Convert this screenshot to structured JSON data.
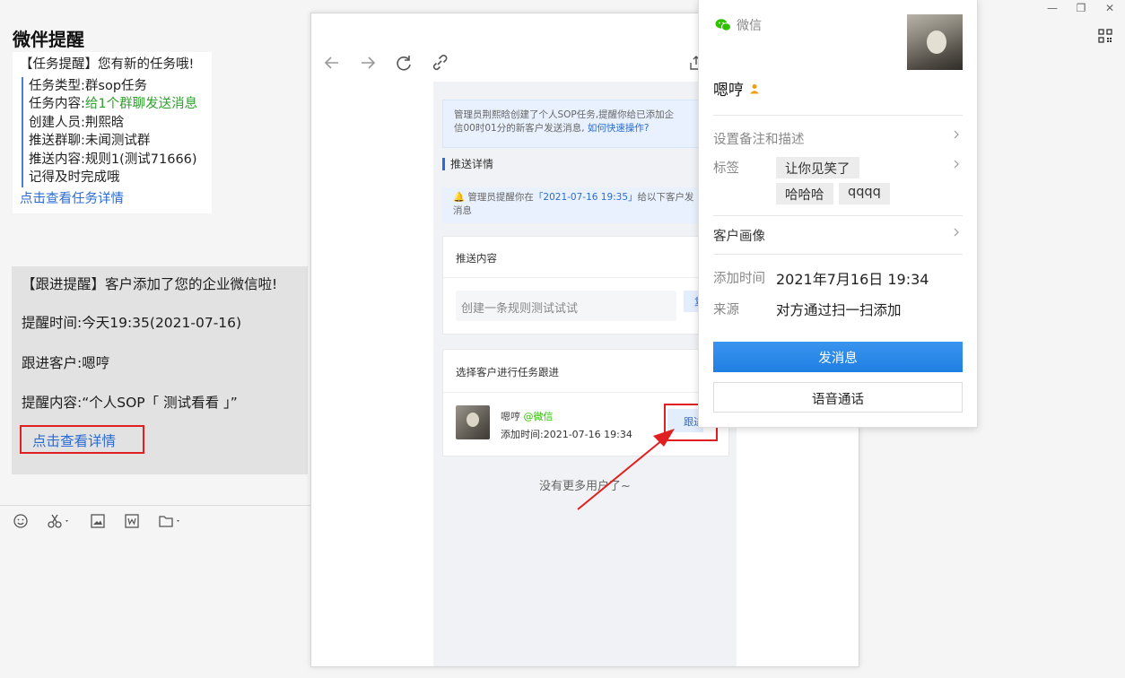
{
  "window": {
    "title": "微伴提醒"
  },
  "message_task": {
    "header": "【任务提醒】您有新的任务哦!",
    "type_label": "任务类型:",
    "type_value": "群sop任务",
    "content_label": "任务内容:",
    "content_value": "给1个群聊发送消息",
    "creator_label": "创建人员:",
    "creator_value": "荆熙晗",
    "group_label": "推送群聊:",
    "group_value": "未闻测试群",
    "push_label": "推送内容:",
    "push_value": "规则1(测试71666)",
    "reminder": "记得及时完成哦",
    "link": "点击查看任务详情"
  },
  "message_followup": {
    "header": "【跟进提醒】客户添加了您的企业微信啦!",
    "time_line": "提醒时间:今天19:35(2021-07-16)",
    "customer_line": "跟进客户:嗯哼",
    "content_line": "提醒内容:“个人SOP「 测试看看 」”",
    "link": "点击查看详情"
  },
  "toolbar": {
    "icons": [
      "emoji-icon",
      "scissors-icon",
      "image-icon",
      "word-icon",
      "folder-icon"
    ]
  },
  "mini_program": {
    "tip1_text": "管理员荆熙晗创建了个人SOP任务,提醒你给已添加企",
    "tip1_text2": "信00时01分的新客户发送消息,",
    "tip1_link": "如何快速操作?",
    "section_title": "推送详情",
    "tip2_prefix": "管理员提醒你在",
    "tip2_time": "「2021-07-16 19:35」",
    "tip2_suffix": "给以下客户发",
    "tip2_line2": "消息",
    "push_card_title": "推送内容",
    "push_content": "创建一条规则测试试试",
    "copy_button": "复制",
    "select_card_title": "选择客户进行任务跟进",
    "customer_name": "嗯哼",
    "customer_source": "@微信",
    "customer_added": "添加时间:2021-07-16 19:34",
    "follow_button": "跟进",
    "no_more": "没有更多用户了~"
  },
  "profile": {
    "source": "微信",
    "name": "嗯哼",
    "remark_label": "设置备注和描述",
    "tags_label": "标签",
    "tags": [
      "让你见笑了",
      "哈哈哈",
      "qqqq"
    ],
    "portrait_label": "客户画像",
    "added_label": "添加时间",
    "added_value": "2021年7月16日 19:34",
    "source_label": "来源",
    "source_value": "对方通过扫一扫添加",
    "send_button": "发消息",
    "voice_button": "语音通话"
  },
  "colors": {
    "accent_blue": "#2b6cd4",
    "primary_button": "#1f7fe2",
    "highlight_red": "#e02020",
    "green_text": "#2ca02c",
    "wechat_green": "#2dc100"
  }
}
